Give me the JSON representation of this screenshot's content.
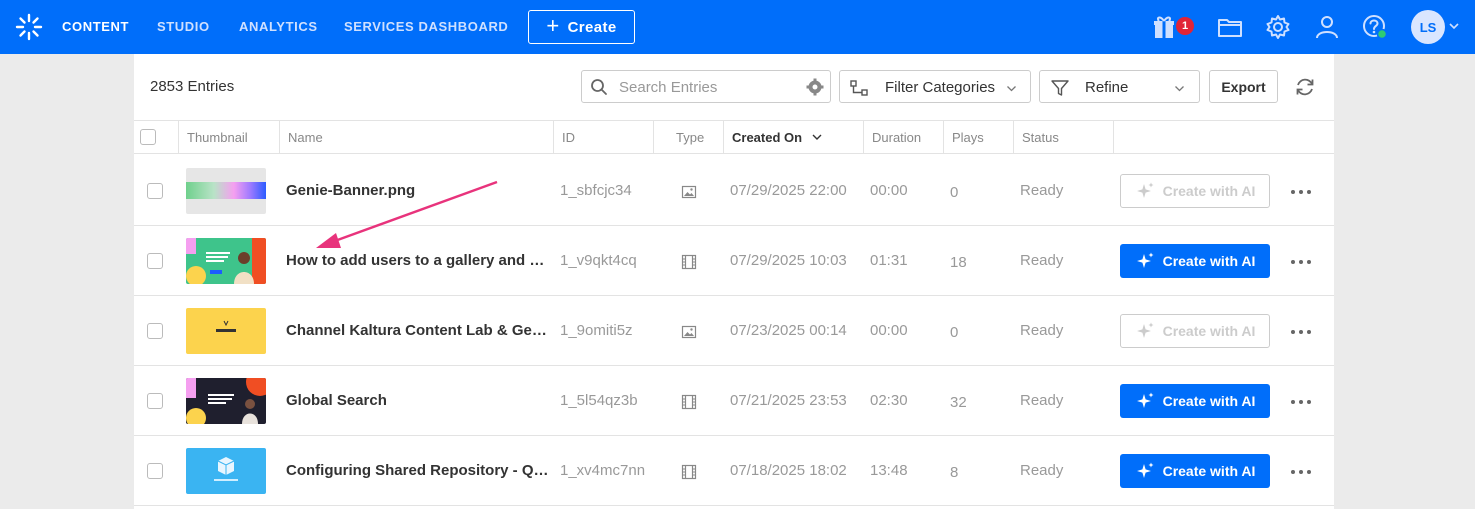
{
  "header": {
    "nav": [
      {
        "label": "CONTENT",
        "active": true
      },
      {
        "label": "STUDIO",
        "active": false
      },
      {
        "label": "ANALYTICS",
        "active": false
      },
      {
        "label": "SERVICES DASHBOARD",
        "active": false
      }
    ],
    "create_label": "Create",
    "notification_count": "1",
    "avatar_initials": "LS",
    "icons": [
      "kaltura-logo-icon",
      "gift-icon",
      "folder-icon",
      "gear-icon",
      "user-icon",
      "help-icon",
      "chevron-down-icon"
    ]
  },
  "toolbar": {
    "entries_count": "2853 Entries",
    "search_placeholder": "Search Entries",
    "filter_categories_label": "Filter Categories",
    "refine_label": "Refine",
    "export_label": "Export"
  },
  "table": {
    "columns": [
      "Thumbnail",
      "Name",
      "ID",
      "Type",
      "Created On",
      "Duration",
      "Plays",
      "Status"
    ],
    "sorted_column": "Created On",
    "rows": [
      {
        "name": "Genie-Banner.png",
        "id": "1_sbfcjc34",
        "type": "image",
        "created": "07/29/2025 22:00",
        "duration": "00:00",
        "plays": "0",
        "status": "Ready",
        "ai_label": "Create with AI",
        "ai_enabled": false
      },
      {
        "name": "How to add users to a gallery and set their permissions",
        "id": "1_v9qkt4cq",
        "type": "video",
        "created": "07/29/2025 10:03",
        "duration": "01:31",
        "plays": "18",
        "status": "Ready",
        "ai_label": "Create with AI",
        "ai_enabled": true
      },
      {
        "name": "Channel Kaltura Content Lab & Genie",
        "id": "1_9omiti5z",
        "type": "image",
        "created": "07/23/2025 00:14",
        "duration": "00:00",
        "plays": "0",
        "status": "Ready",
        "ai_label": "Create with AI",
        "ai_enabled": false
      },
      {
        "name": "Global Search",
        "id": "1_5l54qz3b",
        "type": "video",
        "created": "07/21/2025 23:53",
        "duration": "02:30",
        "plays": "32",
        "status": "Ready",
        "ai_label": "Create with AI",
        "ai_enabled": true
      },
      {
        "name": "Configuring Shared Repository - Quiz",
        "id": "1_xv4mc7nn",
        "type": "video",
        "created": "07/18/2025 18:02",
        "duration": "13:48",
        "plays": "8",
        "status": "Ready",
        "ai_label": "Create with AI",
        "ai_enabled": true
      }
    ]
  },
  "colors": {
    "brand_blue": "#006efa",
    "annotation_arrow": "#e8337c",
    "badge_red": "#e12437"
  }
}
